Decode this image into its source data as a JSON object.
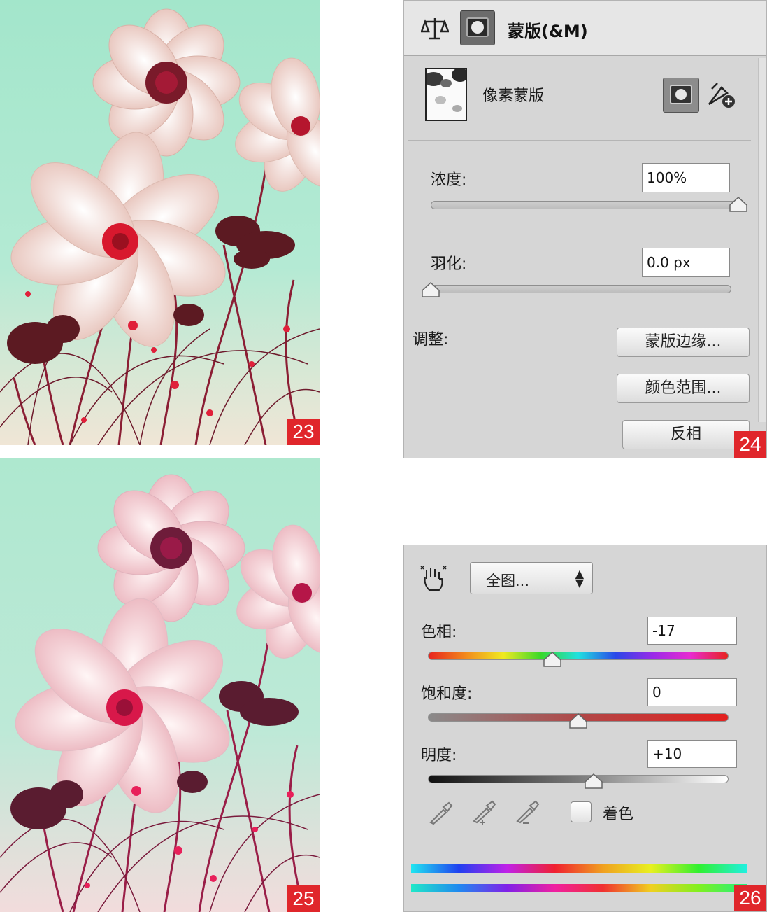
{
  "figures": {
    "f23": "23",
    "f24": "24",
    "f25": "25",
    "f26": "26"
  },
  "masks_panel": {
    "title": "蒙版(&M)",
    "mask_type": "像素蒙版",
    "density_label": "浓度:",
    "density_value": "100%",
    "density_level": 1.0,
    "feather_label": "羽化:",
    "feather_value": "0.0 px",
    "feather_level": 0.0,
    "refine_label": "调整:",
    "mask_edge_button": "蒙版边缘...",
    "color_range_button": "颜色范围...",
    "invert_button": "反相"
  },
  "hue_sat_panel": {
    "preset_value": "全图...",
    "hue_label": "色相:",
    "hue_value": "-17",
    "hue_level": 0.415,
    "saturation_label": "饱和度:",
    "saturation_value": "0",
    "saturation_level": 0.5,
    "lightness_label": "明度:",
    "lightness_value": "+10",
    "lightness_level": 0.55,
    "colorize_label": "着色",
    "colorize_checked": false
  },
  "icons": {
    "balance": "balance-scale-icon",
    "mask": "layer-mask-icon",
    "vector_mask": "vector-mask-add-icon",
    "hand": "targeted-adjustment-hand-icon",
    "eyedropper": "eyedropper-icon",
    "eyedropper_add": "eyedropper-add-icon",
    "eyedropper_sub": "eyedropper-subtract-icon"
  },
  "colors": {
    "badge": "#e0262b",
    "panel_bg": "#d6d6d6",
    "sky": "#a8e6cc"
  }
}
